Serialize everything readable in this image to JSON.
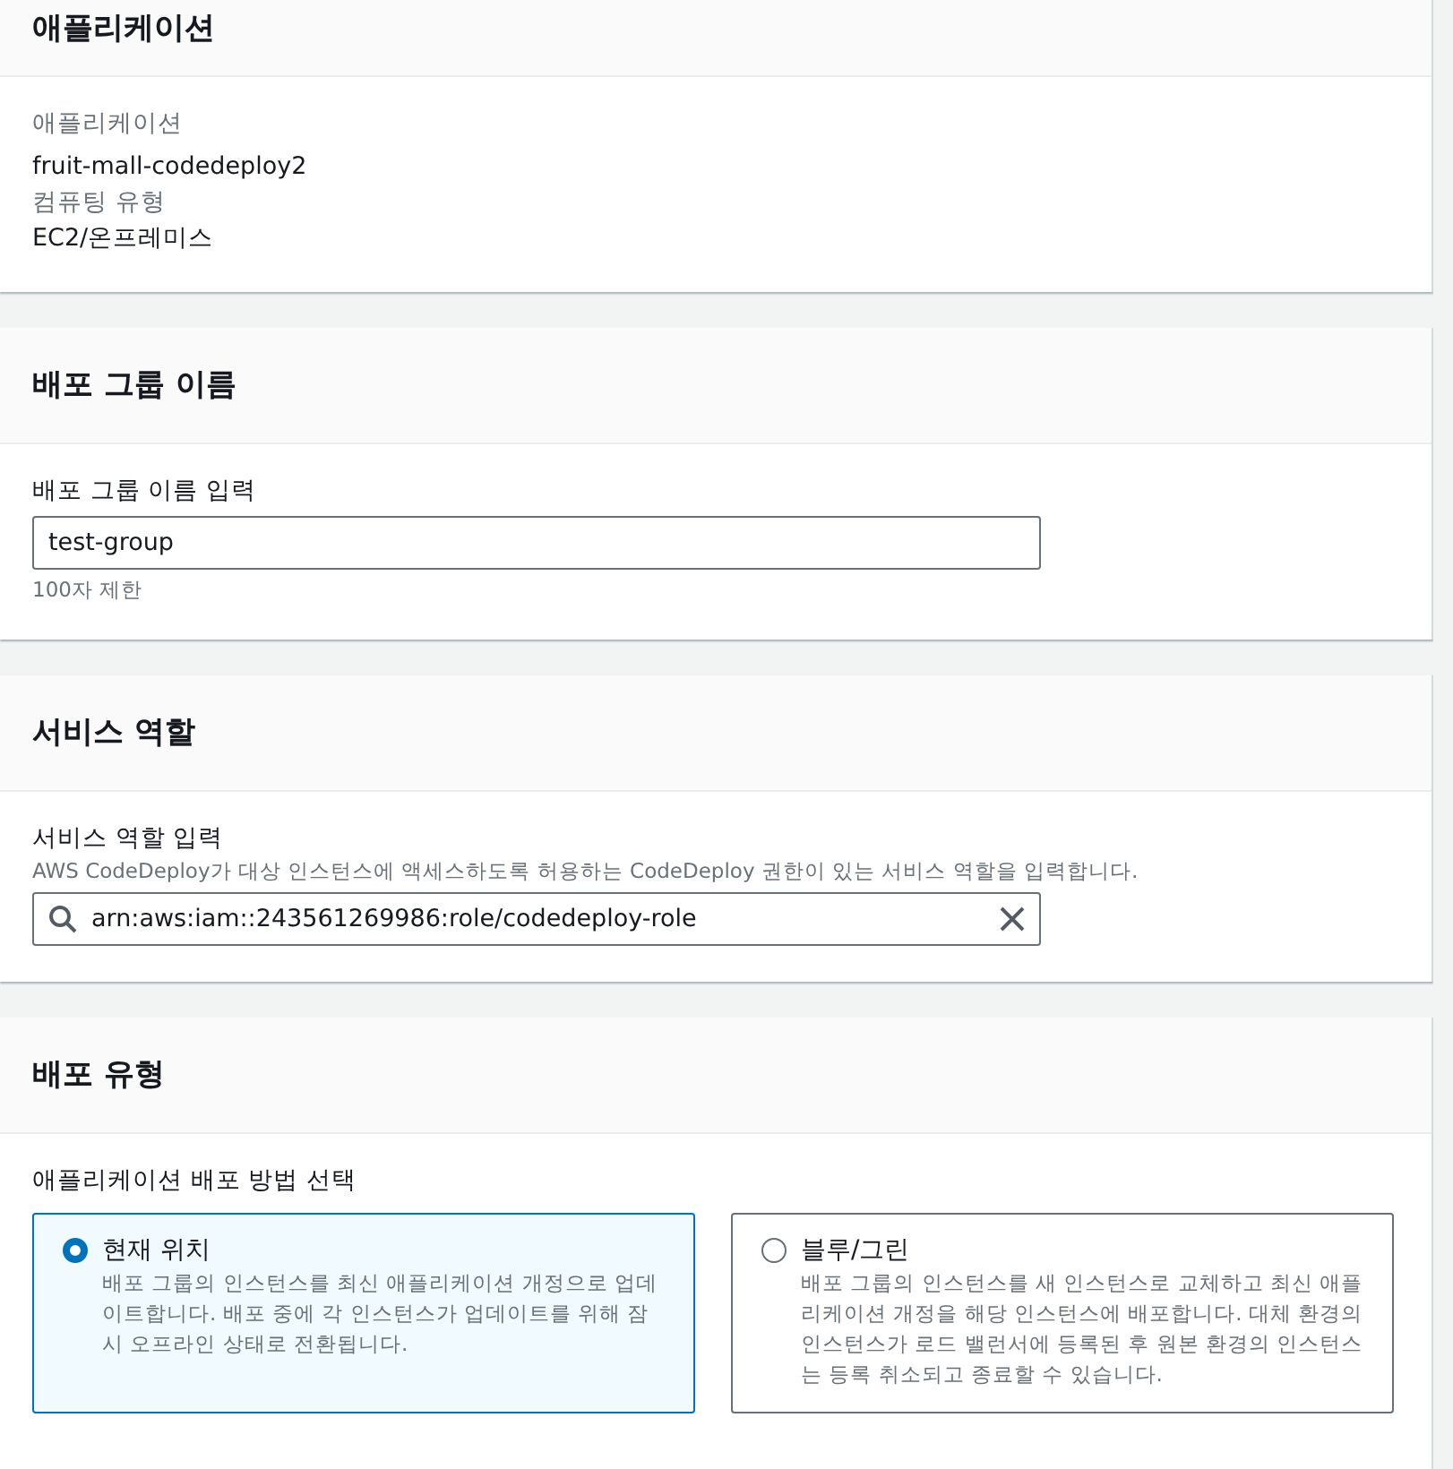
{
  "application_panel": {
    "title": "애플리케이션",
    "fields": [
      {
        "label": "애플리케이션",
        "value": "fruit-mall-codedeploy2"
      },
      {
        "label": "컴퓨팅 유형",
        "value": "EC2/온프레미스"
      }
    ]
  },
  "group_name_panel": {
    "title": "배포 그룹 이름",
    "label": "배포 그룹 이름 입력",
    "value": "test-group",
    "hint": "100자 제한"
  },
  "service_role_panel": {
    "title": "서비스 역할",
    "label": "서비스 역할 입력",
    "description": "AWS CodeDeploy가 대상 인스턴스에 액세스하도록 허용하는 CodeDeploy 권한이 있는 서비스 역할을 입력합니다.",
    "value": "arn:aws:iam::243561269986:role/codedeploy-role"
  },
  "deployment_type_panel": {
    "title": "배포 유형",
    "label": "애플리케이션 배포 방법 선택",
    "options": [
      {
        "label": "현재 위치",
        "description": "배포 그룹의 인스턴스를 최신 애플리케이션 개정으로 업데이트합니다. 배포 중에 각 인스턴스가 업데이트를 위해 잠시 오프라인 상태로 전환됩니다.",
        "selected": true
      },
      {
        "label": "블루/그린",
        "description": "배포 그룹의 인스턴스를 새 인스턴스로 교체하고 최신 애플리케이션 개정을 해당 인스턴스에 배포합니다. 대체 환경의 인스턴스가 로드 밸런서에 등록된 후 원본 환경의 인스턴스는 등록 취소되고 종료할 수 있습니다.",
        "selected": false
      }
    ]
  }
}
